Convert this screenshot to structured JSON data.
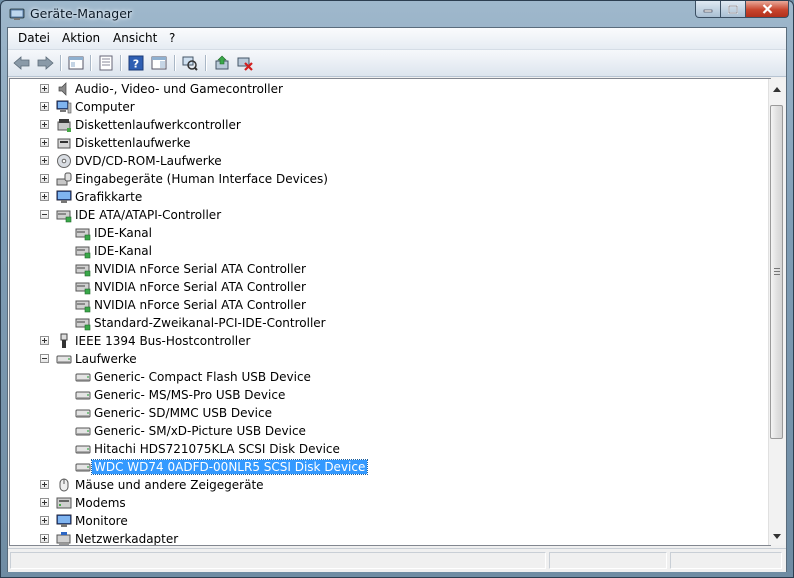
{
  "window": {
    "title": "Geräte-Manager"
  },
  "menu": [
    "Datei",
    "Aktion",
    "Ansicht",
    "?"
  ],
  "toolbar": {
    "buttons": [
      {
        "name": "back-arrow-icon"
      },
      {
        "name": "forward-arrow-icon"
      },
      {
        "name": "show-hide-console-tree-icon"
      },
      {
        "name": "properties-icon"
      },
      {
        "name": "help-icon"
      },
      {
        "name": "action-pane-icon"
      },
      {
        "name": "scan-hardware-icon"
      },
      {
        "name": "update-driver-icon"
      },
      {
        "name": "uninstall-device-icon"
      }
    ]
  },
  "tree": {
    "rows": [
      {
        "level": 0,
        "expander": "plus",
        "icon": "audio-icon",
        "label": "Audio-, Video- und Gamecontroller"
      },
      {
        "level": 0,
        "expander": "plus",
        "icon": "computer-icon",
        "label": "Computer"
      },
      {
        "level": 0,
        "expander": "plus",
        "icon": "floppy-controller-icon",
        "label": "Diskettenlaufwerkcontroller"
      },
      {
        "level": 0,
        "expander": "plus",
        "icon": "floppy-drive-icon",
        "label": "Diskettenlaufwerke"
      },
      {
        "level": 0,
        "expander": "plus",
        "icon": "dvd-icon",
        "label": "DVD/CD-ROM-Laufwerke"
      },
      {
        "level": 0,
        "expander": "plus",
        "icon": "hid-icon",
        "label": "Eingabegeräte (Human Interface Devices)"
      },
      {
        "level": 0,
        "expander": "plus",
        "icon": "display-icon",
        "label": "Grafikkarte"
      },
      {
        "level": 0,
        "expander": "minus",
        "icon": "ide-controller-icon",
        "label": "IDE ATA/ATAPI-Controller"
      },
      {
        "level": 1,
        "expander": "none",
        "icon": "ide-controller-icon",
        "label": "IDE-Kanal"
      },
      {
        "level": 1,
        "expander": "none",
        "icon": "ide-controller-icon",
        "label": "IDE-Kanal"
      },
      {
        "level": 1,
        "expander": "none",
        "icon": "ide-controller-icon",
        "label": "NVIDIA nForce Serial ATA Controller"
      },
      {
        "level": 1,
        "expander": "none",
        "icon": "ide-controller-icon",
        "label": "NVIDIA nForce Serial ATA Controller"
      },
      {
        "level": 1,
        "expander": "none",
        "icon": "ide-controller-icon",
        "label": "NVIDIA nForce Serial ATA Controller"
      },
      {
        "level": 1,
        "expander": "none",
        "icon": "ide-controller-icon",
        "label": "Standard-Zweikanal-PCI-IDE-Controller"
      },
      {
        "level": 0,
        "expander": "plus",
        "icon": "firewire-icon",
        "label": "IEEE 1394 Bus-Hostcontroller"
      },
      {
        "level": 0,
        "expander": "minus",
        "icon": "disk-drive-icon",
        "label": "Laufwerke"
      },
      {
        "level": 1,
        "expander": "none",
        "icon": "disk-drive-icon",
        "label": "Generic- Compact Flash USB Device"
      },
      {
        "level": 1,
        "expander": "none",
        "icon": "disk-drive-icon",
        "label": "Generic- MS/MS-Pro USB Device"
      },
      {
        "level": 1,
        "expander": "none",
        "icon": "disk-drive-icon",
        "label": "Generic- SD/MMC USB Device"
      },
      {
        "level": 1,
        "expander": "none",
        "icon": "disk-drive-icon",
        "label": "Generic- SM/xD-Picture USB Device"
      },
      {
        "level": 1,
        "expander": "none",
        "icon": "disk-drive-icon",
        "label": "Hitachi HDS721075KLA SCSI Disk Device"
      },
      {
        "level": 1,
        "expander": "none",
        "icon": "disk-drive-icon",
        "label": "WDC WD74 0ADFD-00NLR5 SCSI Disk Device",
        "selected": true
      },
      {
        "level": 0,
        "expander": "plus",
        "icon": "mouse-icon",
        "label": "Mäuse und andere Zeigegeräte"
      },
      {
        "level": 0,
        "expander": "plus",
        "icon": "modem-icon",
        "label": "Modems"
      },
      {
        "level": 0,
        "expander": "plus",
        "icon": "monitor-icon",
        "label": "Monitore"
      },
      {
        "level": 0,
        "expander": "plus",
        "icon": "network-adapter-icon",
        "label": "Netzwerkadapter"
      }
    ]
  },
  "colors": {
    "selection": "#3399ff",
    "window_frame": "#7f9db5",
    "close_button": "#c8452d"
  }
}
